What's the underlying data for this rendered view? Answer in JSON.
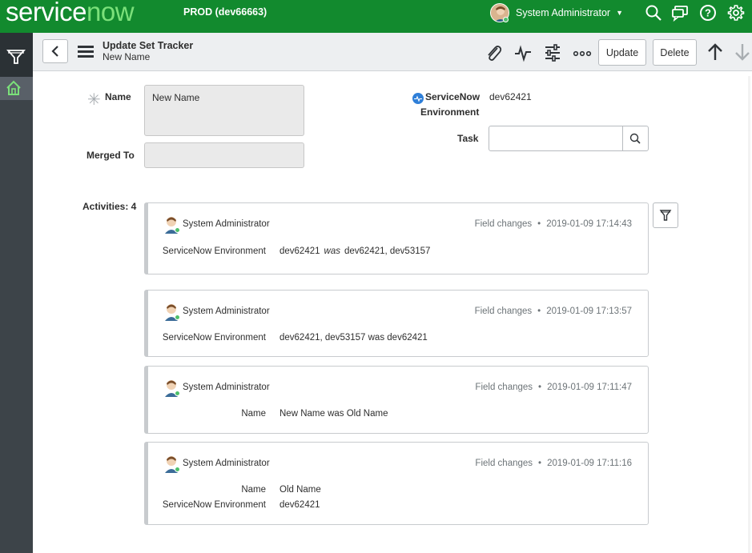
{
  "banner": {
    "logo_text": "servicenow",
    "instance": "PROD (dev66663)",
    "user_name": "System Administrator"
  },
  "header": {
    "title": "Update Set Tracker",
    "subtitle": "New Name",
    "update_label": "Update",
    "delete_label": "Delete"
  },
  "form": {
    "name_label": "Name",
    "name_value": "New Name",
    "merged_to_label": "Merged To",
    "merged_to_value": "",
    "env_label_line1": "ServiceNow",
    "env_label_line2": "Environment",
    "env_value": "dev62421",
    "task_label": "Task",
    "task_value": "",
    "activities_label": "Activities: 4"
  },
  "activities": [
    {
      "user": "System Administrator",
      "type": "Field changes",
      "timestamp": "2019-01-09 17:14:43",
      "rows": [
        {
          "label": "ServiceNow Environment",
          "value": "dev62421",
          "was": "was",
          "old": "dev62421, dev53157"
        }
      ]
    },
    {
      "user": "System Administrator",
      "type": "Field changes",
      "timestamp": "2019-01-09 17:13:57",
      "rows": [
        {
          "label": "ServiceNow Environment",
          "value": "dev62421, dev53157 was dev62421"
        }
      ]
    },
    {
      "user": "System Administrator",
      "type": "Field changes",
      "timestamp": "2019-01-09 17:11:47",
      "rows": [
        {
          "label": "Name",
          "value": "New Name was Old Name"
        }
      ]
    },
    {
      "user": "System Administrator",
      "type": "Field changes",
      "timestamp": "2019-01-09 17:11:16",
      "rows": [
        {
          "label": "Name",
          "value": "Old Name"
        },
        {
          "label": "ServiceNow Environment",
          "value": "dev62421"
        }
      ]
    }
  ],
  "meta_separator": "•",
  "icons": [
    "search-icon",
    "chat-icon",
    "help-icon",
    "gear-icon",
    "filter-icon",
    "home-icon",
    "chevron-left-icon",
    "hamburger-icon",
    "paperclip-icon",
    "activity-icon",
    "sliders-icon",
    "more-icon",
    "arrow-up-icon",
    "arrow-down-icon",
    "reference-lookup-icon"
  ],
  "colors": {
    "banner": "#128a2e",
    "logo_accent": "#7be07a",
    "nav": "#3d4449"
  }
}
